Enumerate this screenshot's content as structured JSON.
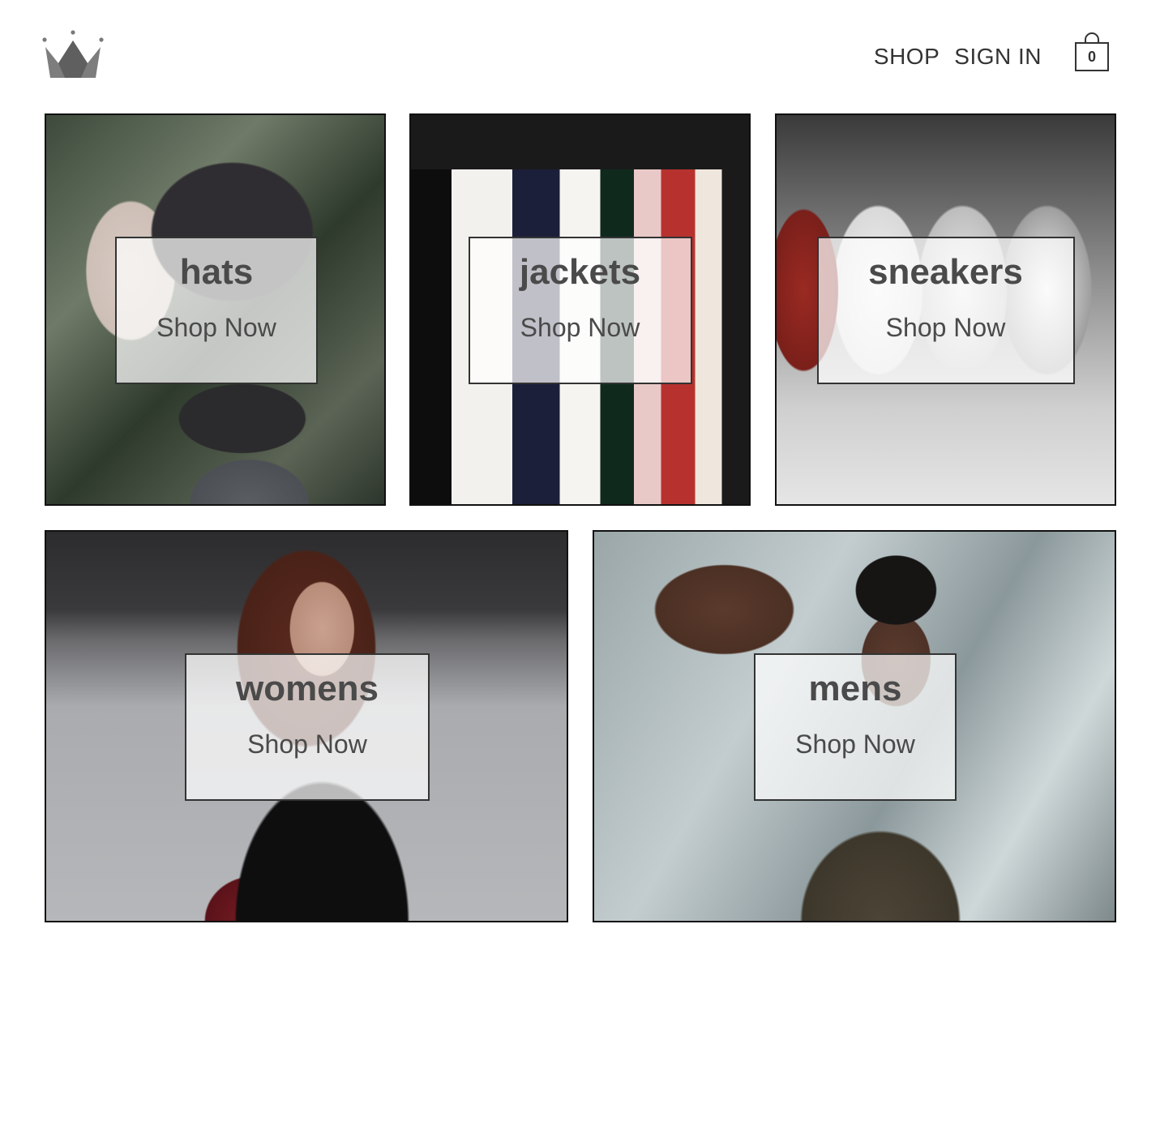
{
  "header": {
    "logo_icon": "crown-icon",
    "nav": [
      {
        "label": "SHOP"
      },
      {
        "label": "SIGN IN"
      }
    ],
    "cart": {
      "icon": "shopping-bag-icon",
      "count": "0"
    }
  },
  "directory": {
    "items": [
      {
        "title": "hats",
        "subtitle": "Shop Now"
      },
      {
        "title": "jackets",
        "subtitle": "Shop Now"
      },
      {
        "title": "sneakers",
        "subtitle": "Shop Now"
      },
      {
        "title": "womens",
        "subtitle": "Shop Now"
      },
      {
        "title": "mens",
        "subtitle": "Shop Now"
      }
    ]
  },
  "colors": {
    "text": "#333333",
    "title_text": "#4a4a4a",
    "border": "#111111",
    "overlay": "rgba(255,255,255,0.72)"
  }
}
